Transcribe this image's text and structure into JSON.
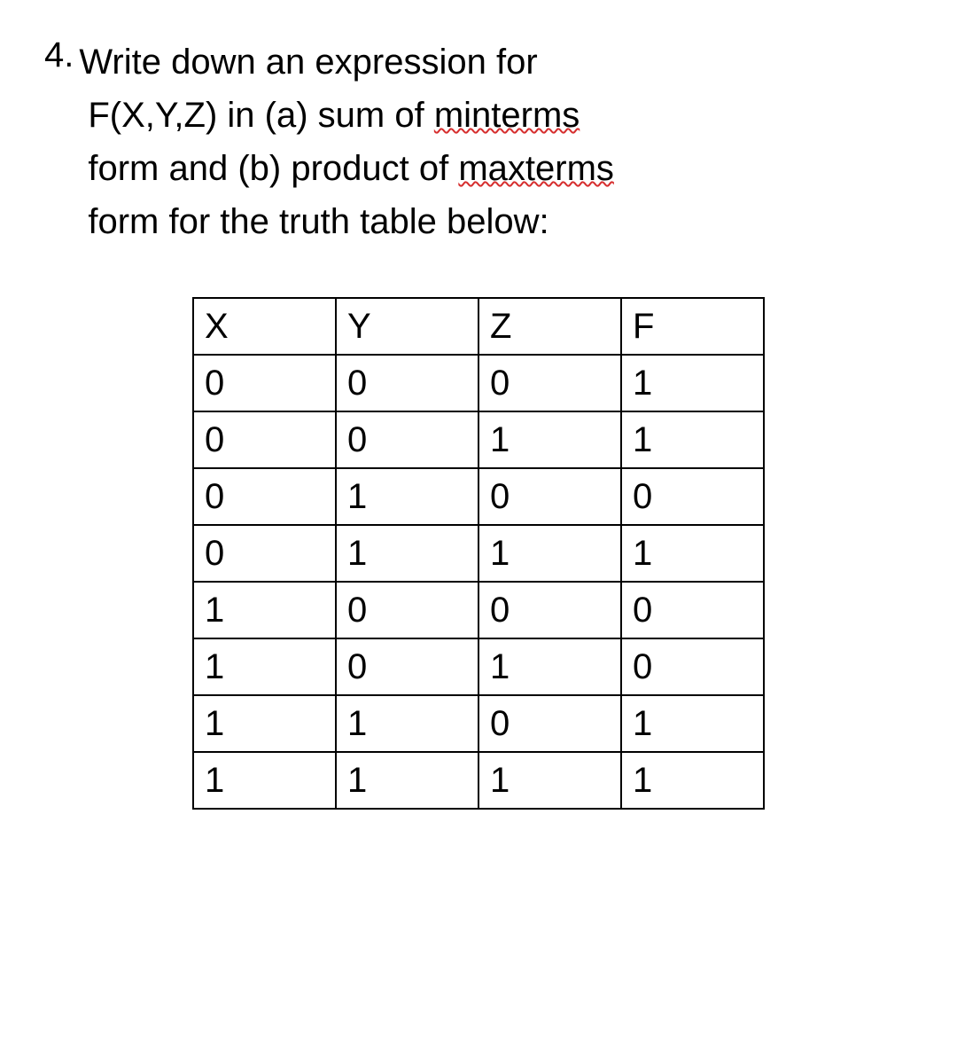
{
  "question": {
    "number": "4.",
    "line1_pre": "Write down an expression for",
    "line2_func": "F(X,Y,Z)",
    "line2_mid": " in (a) sum of ",
    "line2_err1": "minterms",
    "line3_pre": "form and (b) product of ",
    "line3_err2": "maxterms",
    "line4": "form for the truth table below:"
  },
  "table": {
    "headers": [
      "X",
      "Y",
      "Z",
      "F"
    ],
    "rows": [
      [
        "0",
        "0",
        "0",
        "1"
      ],
      [
        "0",
        "0",
        "1",
        "1"
      ],
      [
        "0",
        "1",
        "0",
        "0"
      ],
      [
        "0",
        "1",
        "1",
        "1"
      ],
      [
        "1",
        "0",
        "0",
        "0"
      ],
      [
        "1",
        "0",
        "1",
        "0"
      ],
      [
        "1",
        "1",
        "0",
        "1"
      ],
      [
        "1",
        "1",
        "1",
        "1"
      ]
    ]
  }
}
